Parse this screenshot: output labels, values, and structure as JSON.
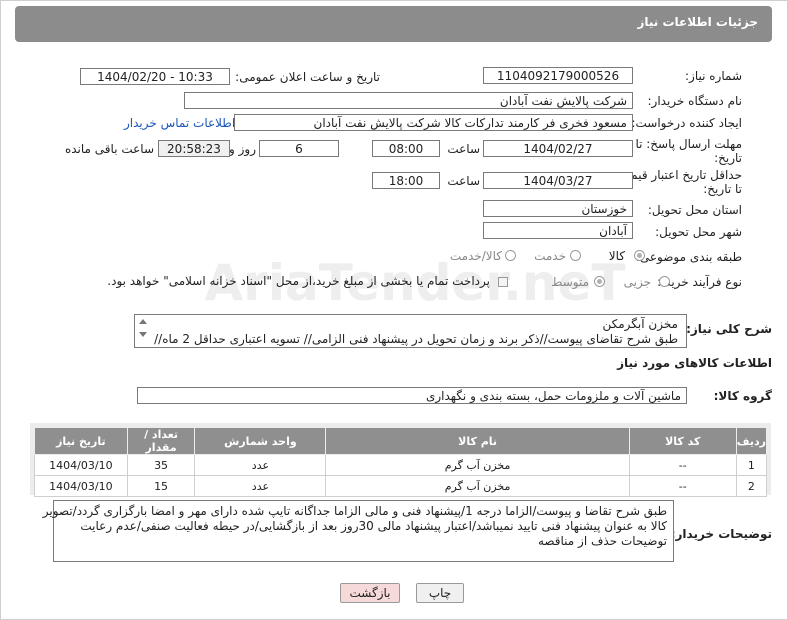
{
  "header": {
    "title": "جزئیات اطلاعات نیاز"
  },
  "fields": {
    "need_number_label": "شماره نیاز:",
    "need_number": "1104092179000526",
    "announce_label": "تاریخ و ساعت اعلان عمومی:",
    "announce_value": "1404/02/20 - 10:33",
    "buyer_org_label": "نام دستگاه خریدار:",
    "buyer_org": "شرکت پالایش نفت آبادان",
    "creator_label": "ایجاد کننده درخواست:",
    "creator": "مسعود فخری فر کارمند تدارکات کالا شرکت پالایش نفت آبادان",
    "contact_link": "اطلاعات تماس خریدار",
    "reply_deadline_label_1": "مهلت ارسال پاسخ: تا",
    "reply_deadline_label_2": "تاریخ:",
    "reply_date": "1404/02/27",
    "time_label": "ساعت",
    "reply_time": "08:00",
    "days_value": "6",
    "days_label": "روز و",
    "remaining_time": "20:58:23",
    "remaining_label": "ساعت باقی مانده",
    "price_validity_label_1": "حداقل تاریخ اعتبار قیمت:",
    "price_validity_label_2": "تا تاریخ:",
    "price_date": "1404/03/27",
    "price_time": "18:00",
    "province_label": "استان محل تحویل:",
    "province": "خوزستان",
    "city_label": "شهر محل تحویل:",
    "city": "آبادان",
    "category_label": "طبقه بندی موضوعی:",
    "category_options": [
      "کالا",
      "خدمت",
      "کالا/خدمت"
    ],
    "process_label": "نوع فرآیند خرید :",
    "process_options": [
      "جزیی",
      "متوسط"
    ],
    "payment_note": "پرداخت تمام یا بخشی از مبلغ خرید،از محل \"اسناد خزانه اسلامی\" خواهد بود."
  },
  "description": {
    "label": "شرح کلی نیاز:",
    "line1": "مخزن آبگرمکن",
    "line2": "طبق شرح تقاضای پیوست//ذکر برند و زمان تحویل در پیشنهاد فنی الزامی// تسویه اعتباری حداقل 2 ماه//"
  },
  "goods": {
    "section_title": "اطلاعات کالاهای مورد نیاز",
    "group_label": "گروه کالا:",
    "group_value": "ماشین آلات و ملزومات حمل، بسته بندی و نگهداری",
    "columns": [
      "ردیف",
      "کد کالا",
      "نام کالا",
      "واحد شمارش",
      "تعداد / مقدار",
      "تاریخ نیاز"
    ],
    "rows": [
      [
        "1",
        "--",
        "مخزن آب گرم",
        "عدد",
        "35",
        "1404/03/10"
      ],
      [
        "2",
        "--",
        "مخزن آب گرم",
        "عدد",
        "15",
        "1404/03/10"
      ]
    ]
  },
  "notes": {
    "label": "توضیحات خریدار:",
    "line1": "طبق شرح تقاضا و پیوست/الزاما درجه 1/پیشنهاد فنی و مالی الزاما جداگانه تایپ شده دارای مهر و امضا بارگزاری گردد/تصویر",
    "line2": "کالا به عنوان پیشنهاد فنی تایید نمیباشد/اعتبار پیشنهاد مالی 30روز بعد از بازگشایی/در حیطه فعالیت صنفی/عدم رعایت",
    "line3": "توضیحات حذف از مناقصه"
  },
  "buttons": {
    "print": "چاپ",
    "back": "بازگشت"
  },
  "watermark": {
    "text": "AriaTender.neT"
  },
  "colors": {
    "header": "#8c8c8c",
    "link": "#1a56b8",
    "back_button_bg": "#f6d9d9"
  }
}
